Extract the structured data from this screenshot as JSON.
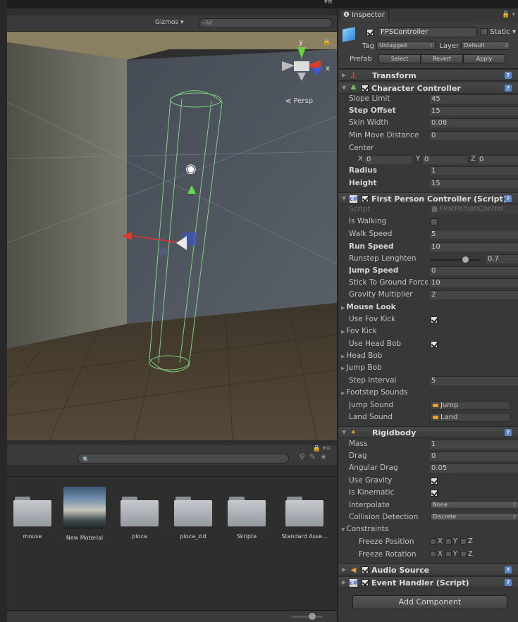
{
  "scene": {
    "gizmos_label": "Gizmos ▾",
    "search_placeholder": "⌕All",
    "persp_label": "⋞ Persp",
    "gizmo_y": "y",
    "gizmo_x": "x",
    "menu_icon": "▾≡",
    "lock_icon": "🔒"
  },
  "project": {
    "search_placeholder": "🔍",
    "assets": [
      {
        "name": "mouse",
        "type": "folder"
      },
      {
        "name": "New Material",
        "type": "material"
      },
      {
        "name": "ploca",
        "type": "folder"
      },
      {
        "name": "ploca_zid",
        "type": "folder"
      },
      {
        "name": "Skripte",
        "type": "folder"
      },
      {
        "name": "Standard Asse...",
        "type": "folder"
      }
    ]
  },
  "inspector": {
    "tab_label": "❶ Inspector",
    "object": {
      "name": "FPSController",
      "active": true,
      "static_label": "Static ▾",
      "tag_label": "Tag",
      "tag_value": "Untagged",
      "layer_label": "Layer",
      "layer_value": "Default",
      "prefab_label": "Prefab",
      "prefab_select": "Select",
      "prefab_revert": "Revert",
      "prefab_apply": "Apply"
    },
    "transform": {
      "title": "Transform"
    },
    "character_controller": {
      "title": "Character Controller",
      "slope_limit": {
        "label": "Slope Limit",
        "value": "45"
      },
      "step_offset": {
        "label": "Step Offset",
        "value": "15"
      },
      "skin_width": {
        "label": "Skin Width",
        "value": "0.08"
      },
      "min_move": {
        "label": "Min Move Distance",
        "value": "0"
      },
      "center": {
        "label": "Center",
        "x_label": "X",
        "x": "0",
        "y_label": "Y",
        "y": "0",
        "z_label": "Z",
        "z": "0"
      },
      "radius": {
        "label": "Radius",
        "value": "1"
      },
      "height": {
        "label": "Height",
        "value": "15"
      }
    },
    "fpc": {
      "title": "First Person Controller (Script)",
      "script": {
        "label": "Script",
        "value": "FirstPersonControl"
      },
      "is_walking": {
        "label": "Is Walking",
        "checked": false
      },
      "walk_speed": {
        "label": "Walk Speed",
        "value": "5"
      },
      "run_speed": {
        "label": "Run Speed",
        "value": "10"
      },
      "runstep": {
        "label": "Runstep Lenghten",
        "value": "0.7",
        "fraction": 0.7
      },
      "jump_speed": {
        "label": "Jump Speed",
        "value": "0"
      },
      "stick": {
        "label": "Stick To Ground Force",
        "value": "10"
      },
      "gravity": {
        "label": "Gravity Multiplier",
        "value": "2"
      },
      "mouse_look": "Mouse Look",
      "use_fov_kick": {
        "label": "Use Fov Kick",
        "checked": true
      },
      "fov_kick": "Fov Kick",
      "use_head_bob": {
        "label": "Use Head Bob",
        "checked": true
      },
      "head_bob": "Head Bob",
      "jump_bob": "Jump Bob",
      "step_interval": {
        "label": "Step Interval",
        "value": "5"
      },
      "footstep": "Footstep Sounds",
      "jump_sound": {
        "label": "Jump Sound",
        "value": "Jump"
      },
      "land_sound": {
        "label": "Land Sound",
        "value": "Land"
      }
    },
    "rigidbody": {
      "title": "Rigidbody",
      "mass": {
        "label": "Mass",
        "value": "1"
      },
      "drag": {
        "label": "Drag",
        "value": "0"
      },
      "angular_drag": {
        "label": "Angular Drag",
        "value": "0.05"
      },
      "use_gravity": {
        "label": "Use Gravity",
        "checked": true
      },
      "is_kinematic": {
        "label": "Is Kinematic",
        "checked": true
      },
      "interpolate": {
        "label": "Interpolate",
        "value": "None"
      },
      "collision": {
        "label": "Collision Detection",
        "value": "Discrete"
      },
      "constraints": "Constraints",
      "freeze_position": "Freeze Position",
      "freeze_rotation": "Freeze Rotation",
      "x": "X",
      "y": "Y",
      "z": "Z"
    },
    "audio_source": {
      "title": "Audio Source"
    },
    "event_handler": {
      "title": "Event Handler (Script)"
    },
    "add_component": "Add Component"
  },
  "colors": {
    "accent": "#5b86c9",
    "sound_icon": "#e6a135"
  }
}
